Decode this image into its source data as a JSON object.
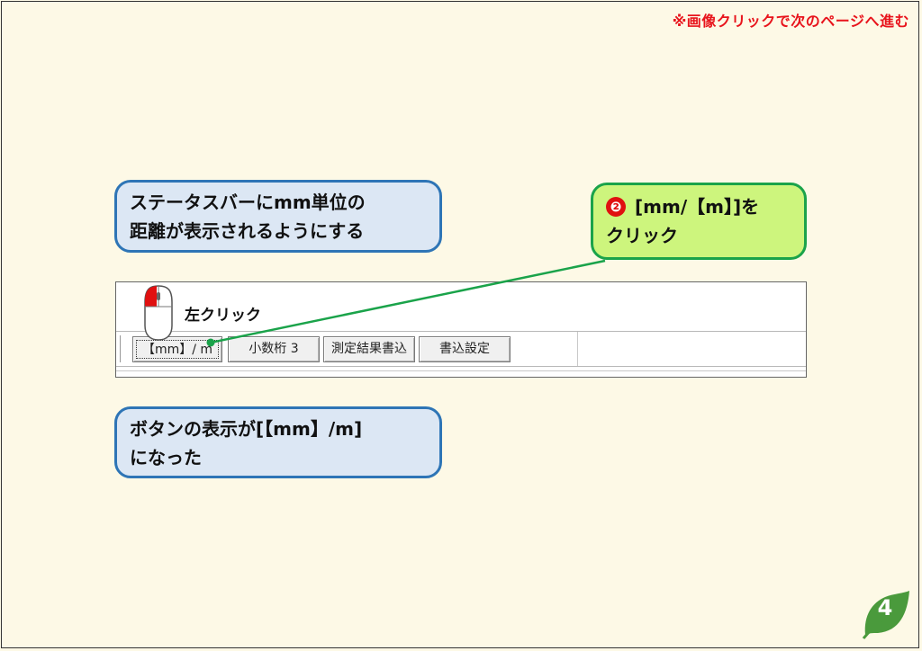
{
  "header": {
    "next_page_note": "※画像クリックで次のページへ進む"
  },
  "callouts": {
    "intro": {
      "line1": "ステータスバーにmm単位の",
      "line2": "距離が表示されるようにする"
    },
    "step": {
      "number": "❷",
      "line1": "[mm/【m】]を",
      "line2": "クリック"
    },
    "result": {
      "line1": "ボタンの表示が[【mm】/m]",
      "line2": "になった"
    }
  },
  "mouse": {
    "label": "左クリック"
  },
  "toolbar": {
    "buttons": [
      {
        "label": "【mm】/ m"
      },
      {
        "label": "小数桁 3"
      },
      {
        "label": "測定結果書込"
      },
      {
        "label": "書込設定"
      }
    ]
  },
  "footer": {
    "page_number": "4"
  },
  "colors": {
    "note_red": "#e8141c",
    "callout_blue_border": "#2e75b6",
    "callout_blue_fill": "#dce7f4",
    "callout_green_border": "#1aa34a",
    "callout_green_fill": "#cdf57d",
    "page_badge_green": "#4a9a3c",
    "background": "#fdf9e6"
  },
  "icons": {
    "mouse": "mouse-left-click-icon",
    "page_badge": "leaf-icon"
  }
}
